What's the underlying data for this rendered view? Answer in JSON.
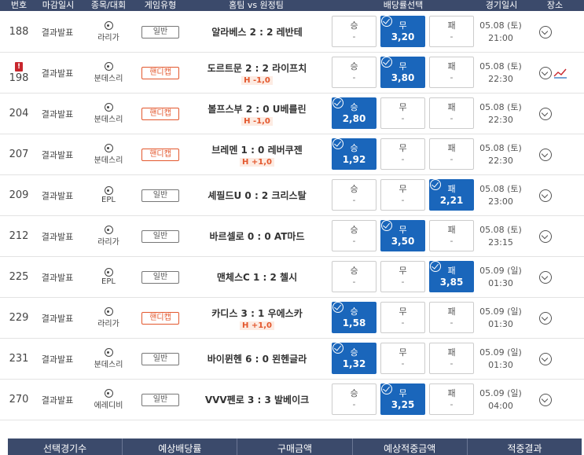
{
  "header": {
    "no": "번호",
    "close": "마감일시",
    "league": "종목/대회",
    "type": "게임유형",
    "match": "홈팀 vs 원정팀",
    "odds": "배당률선택",
    "date": "경기일시",
    "place": "장소"
  },
  "rows": [
    {
      "no": "188",
      "close": "결과발표",
      "league": "라리가",
      "type": "일반",
      "hc": false,
      "match": "알라베스 2 : 2 레반테",
      "line": "",
      "win": {
        "label": "승",
        "val": "-"
      },
      "draw": {
        "label": "무",
        "val": "3,20"
      },
      "lose": {
        "label": "패",
        "val": "-"
      },
      "selected": "draw",
      "date": "05.08 (토)",
      "time": "21:00",
      "warn": false,
      "trend": false
    },
    {
      "no": "198",
      "close": "결과발표",
      "league": "분데스리",
      "type": "핸디캡",
      "hc": true,
      "match": "도르트문 2 : 2 라이프치",
      "line": "H -1,0",
      "win": {
        "label": "승",
        "val": "-"
      },
      "draw": {
        "label": "무",
        "val": "3,80"
      },
      "lose": {
        "label": "패",
        "val": "-"
      },
      "selected": "draw",
      "date": "05.08 (토)",
      "time": "22:30",
      "warn": true,
      "warn_mark": "!",
      "trend": true
    },
    {
      "no": "204",
      "close": "결과발표",
      "league": "분데스리",
      "type": "핸디캡",
      "hc": true,
      "match": "볼프스부 2 : 0 U베를린",
      "line": "H -1,0",
      "win": {
        "label": "승",
        "val": "2,80"
      },
      "draw": {
        "label": "무",
        "val": "-"
      },
      "lose": {
        "label": "패",
        "val": "-"
      },
      "selected": "win",
      "date": "05.08 (토)",
      "time": "22:30",
      "warn": false,
      "trend": false
    },
    {
      "no": "207",
      "close": "결과발표",
      "league": "분데스리",
      "type": "핸디캡",
      "hc": true,
      "match": "브레멘 1 : 0 레버쿠젠",
      "line": "H +1,0",
      "win": {
        "label": "승",
        "val": "1,92"
      },
      "draw": {
        "label": "무",
        "val": "-"
      },
      "lose": {
        "label": "패",
        "val": "-"
      },
      "selected": "win",
      "date": "05.08 (토)",
      "time": "22:30",
      "warn": false,
      "trend": false
    },
    {
      "no": "209",
      "close": "결과발표",
      "league": "EPL",
      "type": "일반",
      "hc": false,
      "match": "셰필드U 0 : 2 크리스탈",
      "line": "",
      "win": {
        "label": "승",
        "val": "-"
      },
      "draw": {
        "label": "무",
        "val": "-"
      },
      "lose": {
        "label": "패",
        "val": "2,21"
      },
      "selected": "lose",
      "date": "05.08 (토)",
      "time": "23:00",
      "warn": false,
      "trend": false
    },
    {
      "no": "212",
      "close": "결과발표",
      "league": "라리가",
      "type": "일반",
      "hc": false,
      "match": "바르셀로 0 : 0 AT마드",
      "line": "",
      "win": {
        "label": "승",
        "val": "-"
      },
      "draw": {
        "label": "무",
        "val": "3,50"
      },
      "lose": {
        "label": "패",
        "val": "-"
      },
      "selected": "draw",
      "date": "05.08 (토)",
      "time": "23:15",
      "warn": false,
      "trend": false
    },
    {
      "no": "225",
      "close": "결과발표",
      "league": "EPL",
      "type": "일반",
      "hc": false,
      "match": "맨체스C 1 : 2 첼시",
      "line": "",
      "win": {
        "label": "승",
        "val": "-"
      },
      "draw": {
        "label": "무",
        "val": "-"
      },
      "lose": {
        "label": "패",
        "val": "3,85"
      },
      "selected": "lose",
      "date": "05.09 (일)",
      "time": "01:30",
      "warn": false,
      "trend": false
    },
    {
      "no": "229",
      "close": "결과발표",
      "league": "라리가",
      "type": "핸디캡",
      "hc": true,
      "match": "카디스 3 : 1 우에스카",
      "line": "H +1,0",
      "win": {
        "label": "승",
        "val": "1,58"
      },
      "draw": {
        "label": "무",
        "val": "-"
      },
      "lose": {
        "label": "패",
        "val": "-"
      },
      "selected": "win",
      "date": "05.09 (일)",
      "time": "01:30",
      "warn": false,
      "trend": false
    },
    {
      "no": "231",
      "close": "결과발표",
      "league": "분데스리",
      "type": "일반",
      "hc": false,
      "match": "바이뮌헨 6 : 0 묀헨글라",
      "line": "",
      "win": {
        "label": "승",
        "val": "1,32"
      },
      "draw": {
        "label": "무",
        "val": "-"
      },
      "lose": {
        "label": "패",
        "val": "-"
      },
      "selected": "win",
      "date": "05.09 (일)",
      "time": "01:30",
      "warn": false,
      "trend": false
    },
    {
      "no": "270",
      "close": "결과발표",
      "league": "에레디비",
      "type": "일반",
      "hc": false,
      "match": "VVV펜로 3 : 3 발베이크",
      "line": "",
      "win": {
        "label": "승",
        "val": "-"
      },
      "draw": {
        "label": "무",
        "val": "3,25"
      },
      "lose": {
        "label": "패",
        "val": "-"
      },
      "selected": "draw",
      "date": "05.09 (일)",
      "time": "04:00",
      "warn": false,
      "trend": false
    }
  ],
  "footer": [
    "선택경기수",
    "예상배당률",
    "구매금액",
    "예상적중금액",
    "적중결과"
  ],
  "colors": {
    "header_bg": "#3b4a6b",
    "selected": "#1a66bb",
    "handicap": "#e3572d"
  }
}
